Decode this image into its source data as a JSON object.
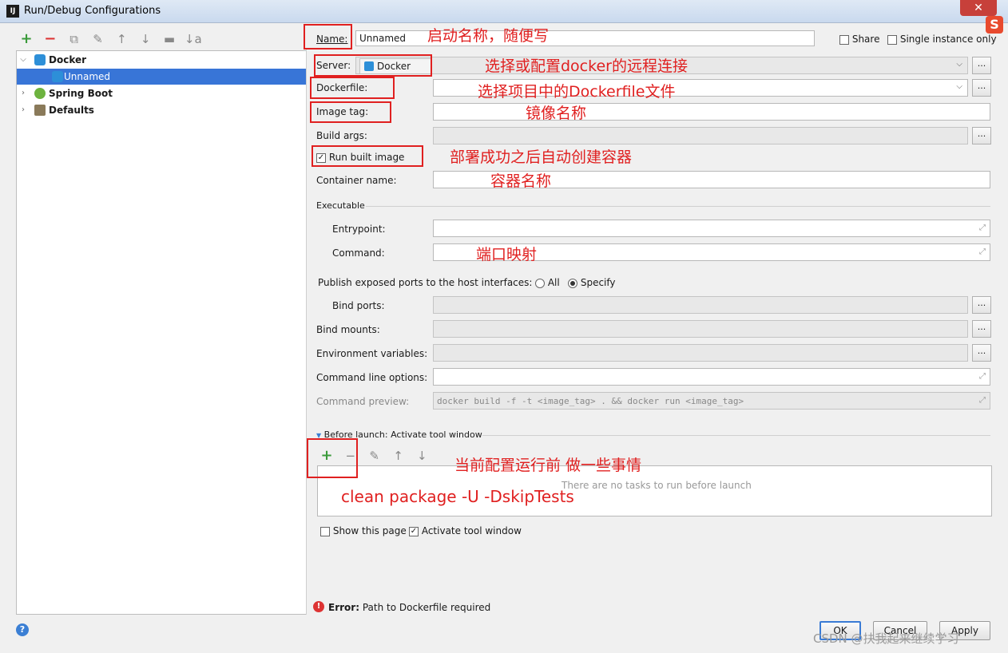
{
  "window": {
    "title": "Run/Debug Configurations",
    "app_icon": "IJ",
    "close_glyph": "✕",
    "ime_glyph": "S"
  },
  "tree": {
    "items": [
      {
        "label": "Docker",
        "icon": "docker-icon",
        "expanded": true
      },
      {
        "label": "Unnamed",
        "icon": "docker-run-icon",
        "selected": true
      },
      {
        "label": "Spring Boot",
        "icon": "spring-boot-icon",
        "expanded": false
      },
      {
        "label": "Defaults",
        "icon": "wrench-icon",
        "expanded": false
      }
    ]
  },
  "form": {
    "name_label": "Name:",
    "name_value": "Unnamed",
    "share_label": "Share",
    "single_instance_label": "Single instance only",
    "server_label": "Server:",
    "server_value": "Docker",
    "dockerfile_label": "Dockerfile:",
    "image_tag_label": "Image tag:",
    "build_args_label": "Build args:",
    "run_built_image_label": "Run built image",
    "container_name_label": "Container name:",
    "executable_label": "Executable",
    "entrypoint_label": "Entrypoint:",
    "command_label": "Command:",
    "publish_label": "Publish exposed ports to the host interfaces:",
    "all_label": "All",
    "specify_label": "Specify",
    "bind_ports_label": "Bind ports:",
    "bind_mounts_label": "Bind mounts:",
    "env_vars_label": "Environment variables:",
    "cmd_options_label": "Command line options:",
    "cmd_preview_label": "Command preview:",
    "cmd_preview_value": "docker build -f  -t <image_tag> . && docker run <image_tag>",
    "before_launch_label": "Before launch: Activate tool window",
    "no_tasks_text": "There are no tasks to run before launch",
    "show_page_label": "Show this page",
    "activate_tool_label": "Activate tool window",
    "dots": "...",
    "dd_arrow": "⌵",
    "expand_glyph": "⤢"
  },
  "toolbar": {
    "add": "+",
    "remove": "−",
    "copy": "⧉",
    "settings": "✎",
    "up": "↑",
    "down": "↓",
    "folder": "▬",
    "sort": "↓a"
  },
  "tasks_toolbar": {
    "add": "+",
    "remove": "−",
    "edit": "✎",
    "up": "↑",
    "down": "↓"
  },
  "error": {
    "prefix": "Error:",
    "text": "Path to Dockerfile required",
    "glyph": "!"
  },
  "buttons": {
    "ok": "OK",
    "cancel": "Cancel",
    "apply": "Apply",
    "help": "?"
  },
  "annotations": {
    "name": "启动名称，随便写",
    "server": "选择或配置docker的远程连接",
    "dockerfile": "选择项目中的Dockerfile文件",
    "image_tag": "镜像名称",
    "run_built": "部署成功之后自动创建容器",
    "container": "容器名称",
    "ports": "端口映射",
    "before_launch": "当前配置运行前 做一些事情",
    "maven": "clean package -U -DskipTests"
  },
  "watermark": "CSDN @扶我起来继续学习",
  "colors": {
    "annotation_red": "#e02020",
    "selection_blue": "#3875d7",
    "add_green": "#3a9a3a",
    "remove_red": "#dd3333"
  }
}
